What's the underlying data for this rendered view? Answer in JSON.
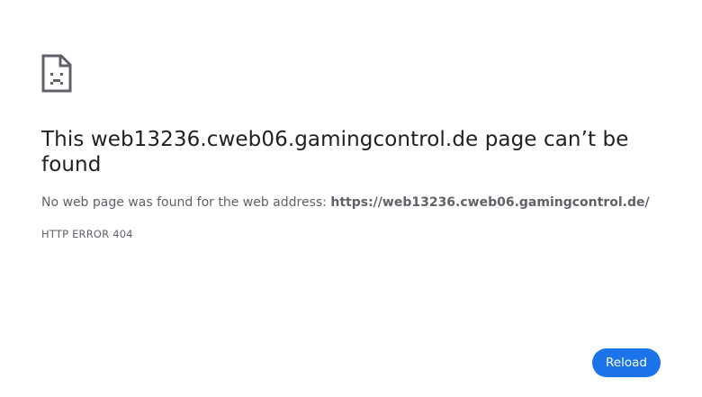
{
  "headline": {
    "prefix": "This ",
    "host": "web13236.cweb06.gamingcontrol.de",
    "suffix": " page can’t be found"
  },
  "description": {
    "text": "No web page was found for the web address: ",
    "url": "https://web13236.cweb06.gamingcontrol.de/"
  },
  "error_code": "HTTP ERROR 404",
  "reload_button": {
    "label": "Reload"
  },
  "icons": {
    "error": "sad-document-icon"
  },
  "colors": {
    "accent": "#1a73e8",
    "text_primary": "#202124",
    "text_secondary": "#5f6368",
    "icon": "#5f6368"
  }
}
